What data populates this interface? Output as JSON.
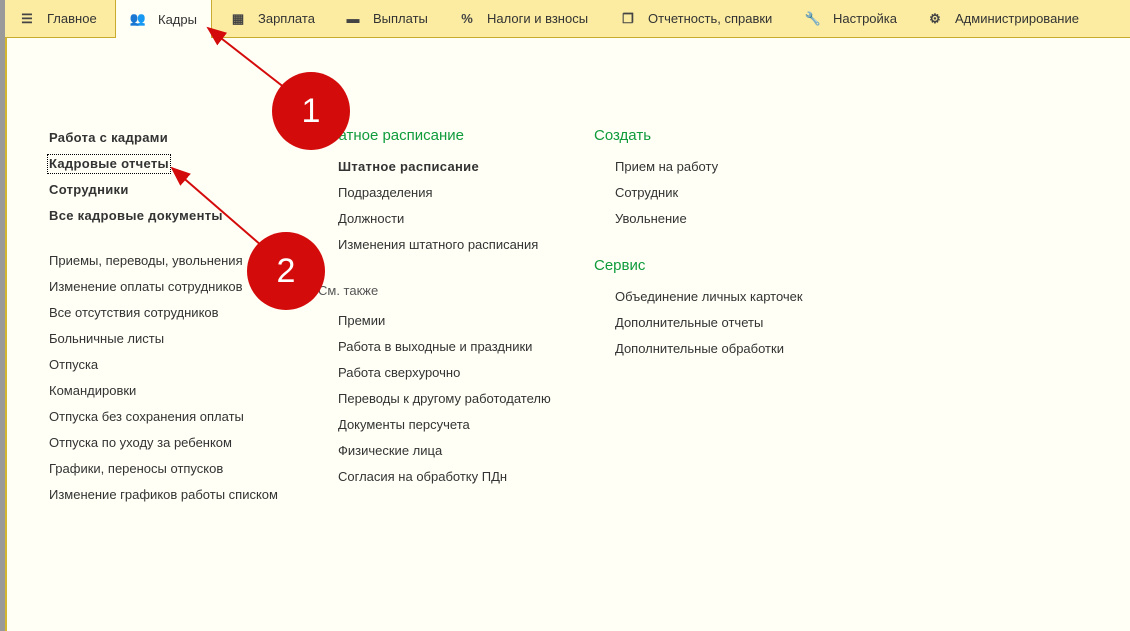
{
  "nav": [
    {
      "label": "Главное",
      "icon": "menu-icon"
    },
    {
      "label": "Кадры",
      "icon": "users-icon"
    },
    {
      "label": "Зарплата",
      "icon": "calculator-icon"
    },
    {
      "label": "Выплаты",
      "icon": "card-icon"
    },
    {
      "label": "Налоги и взносы",
      "icon": "percent-icon"
    },
    {
      "label": "Отчетность, справки",
      "icon": "reports-icon"
    },
    {
      "label": "Настройка",
      "icon": "wrench-icon"
    },
    {
      "label": "Администрирование",
      "icon": "gear-icon"
    }
  ],
  "col1": {
    "bold": [
      "Работа с кадрами",
      "Кадровые отчеты",
      "Сотрудники",
      "Все кадровые документы"
    ],
    "items": [
      "Приемы, переводы, увольнения",
      "Изменение оплаты сотрудников",
      "Все отсутствия сотрудников",
      "Больничные листы",
      "Отпуска",
      "Командировки",
      "Отпуска без сохранения оплаты",
      "Отпуска по уходу за ребенком",
      "Графики, переносы отпусков",
      "Изменение графиков работы списком"
    ]
  },
  "col2": {
    "heading": "Штатное расписание",
    "bold": "Штатное расписание",
    "items": [
      "Подразделения",
      "Должности",
      "Изменения штатного расписания"
    ],
    "see_also": "См. также",
    "also_items": [
      "Премии",
      "Работа в выходные и праздники",
      "Работа сверхурочно",
      "Переводы к другому работодателю",
      "Документы персучета",
      "Физические лица",
      "Согласия на обработку ПДн"
    ]
  },
  "col3": {
    "create_heading": "Создать",
    "create_items": [
      "Прием на работу",
      "Сотрудник",
      "Увольнение"
    ],
    "service_heading": "Сервис",
    "service_items": [
      "Объединение личных карточек",
      "Дополнительные отчеты",
      "Дополнительные обработки"
    ]
  },
  "callouts": [
    "1",
    "2"
  ]
}
